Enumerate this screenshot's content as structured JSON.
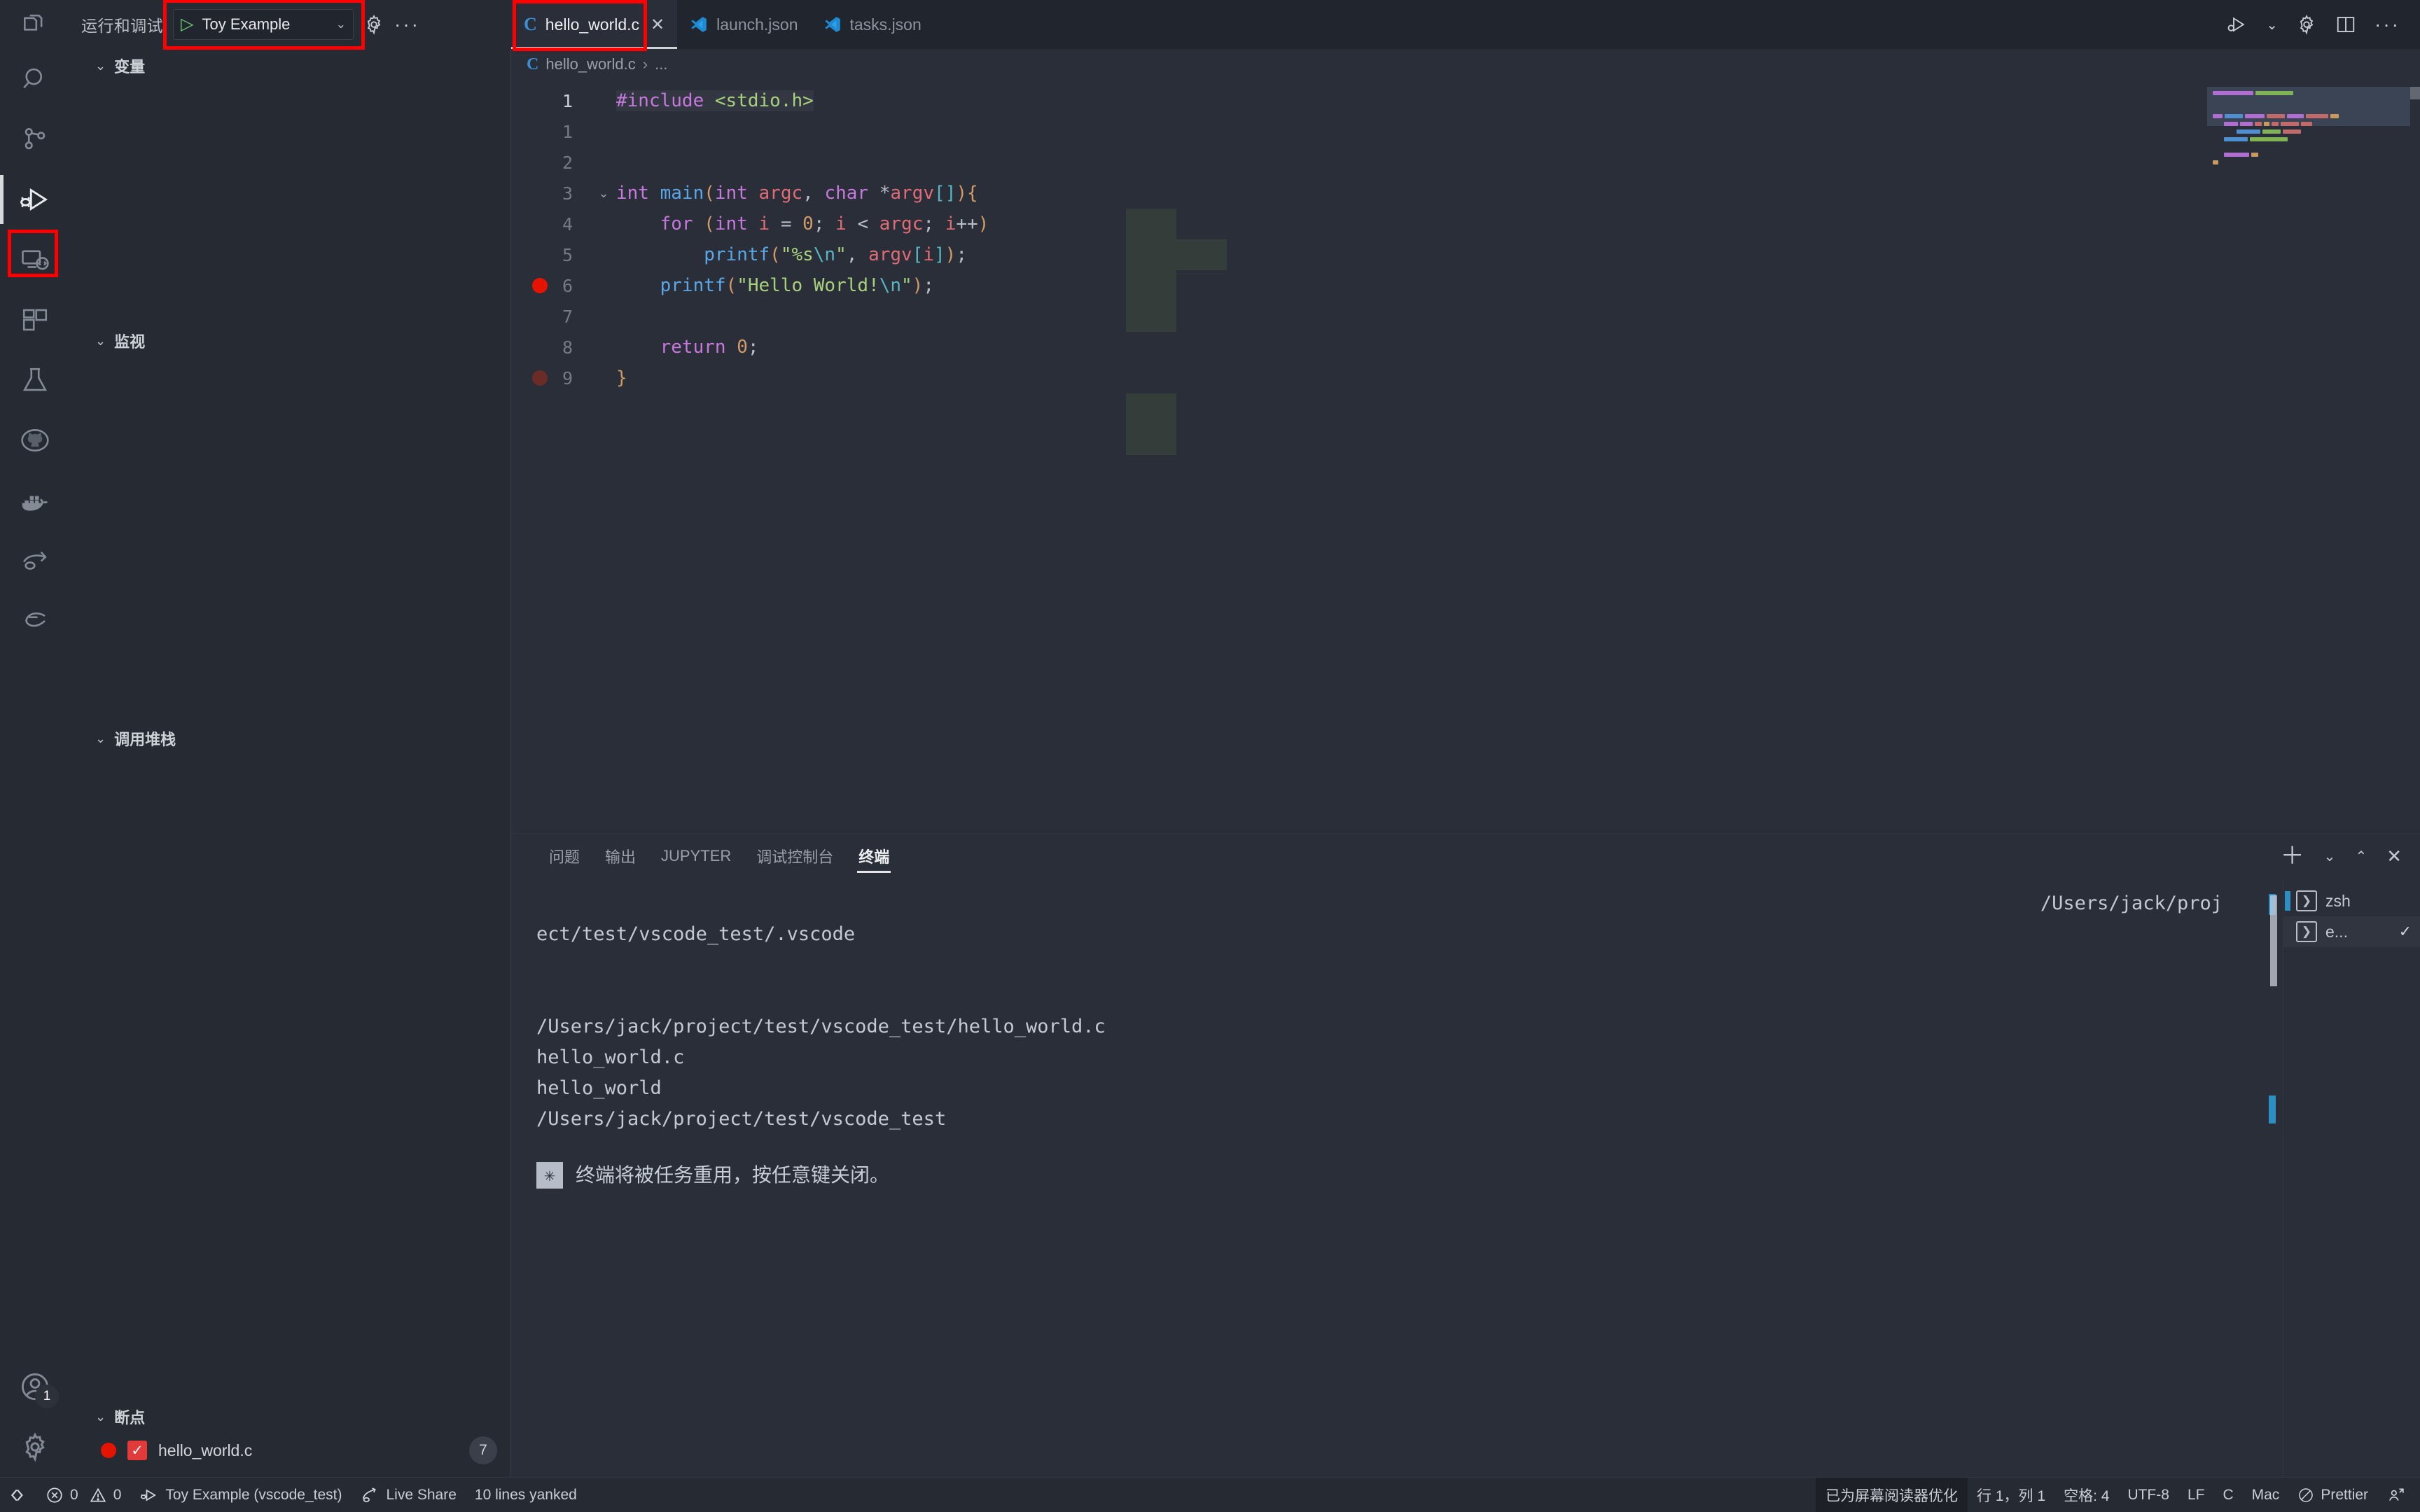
{
  "debug_header": {
    "title": "运行和调试",
    "config_name": "Toy Example",
    "play_icon": "play-icon",
    "chevron": "chevron-down-icon",
    "gear_icon": "gear-icon",
    "more_icon": "ellipsis-icon"
  },
  "activity_bar": {
    "items": [
      {
        "name": "explorer",
        "icon": "files-icon"
      },
      {
        "name": "search",
        "icon": "search-icon"
      },
      {
        "name": "source-control",
        "icon": "source-control-icon"
      },
      {
        "name": "run-and-debug",
        "icon": "run-debug-icon",
        "active": true
      },
      {
        "name": "remote-explorer",
        "icon": "remote-explorer-icon"
      },
      {
        "name": "extensions",
        "icon": "extensions-icon"
      },
      {
        "name": "testing",
        "icon": "beaker-icon"
      },
      {
        "name": "github",
        "icon": "github-icon"
      },
      {
        "name": "docker",
        "icon": "docker-icon"
      },
      {
        "name": "live-share",
        "icon": "live-share-icon"
      },
      {
        "name": "codeium",
        "icon": "codeium-icon"
      }
    ],
    "account_badge": "1",
    "account_icon": "account-icon",
    "settings_icon": "gear-icon"
  },
  "sidebar": {
    "sections": [
      {
        "label": "变量",
        "expanded": true
      },
      {
        "label": "监视",
        "expanded": true
      },
      {
        "label": "调用堆栈",
        "expanded": true
      },
      {
        "label": "断点",
        "expanded": true
      }
    ],
    "breakpoints": [
      {
        "file": "hello_world.c",
        "line": "7",
        "enabled": true
      }
    ]
  },
  "tabs": [
    {
      "label": "hello_world.c",
      "icon": "c-file-icon",
      "active": true,
      "close": "✕"
    },
    {
      "label": "launch.json",
      "icon": "json-vscode-icon",
      "active": false
    },
    {
      "label": "tasks.json",
      "icon": "json-vscode-icon",
      "active": false
    }
  ],
  "tabbar_actions": [
    {
      "name": "run-debug-dropdown",
      "icon": "run-debug-icon"
    },
    {
      "name": "chevron-down-icon",
      "icon": "chevron-down-icon"
    },
    {
      "name": "settings",
      "icon": "gear-icon"
    },
    {
      "name": "split-editor",
      "icon": "split-editor-icon"
    },
    {
      "name": "more-actions",
      "icon": "ellipsis-icon"
    }
  ],
  "breadcrumb": {
    "icon": "c-file-icon",
    "file": "hello_world.c",
    "separator": "›",
    "more": "..."
  },
  "editor": {
    "lines": [
      {
        "num": "1",
        "current": true,
        "breakpoint": "none",
        "tokens": [
          {
            "t": "#include ",
            "c": "pre"
          },
          {
            "t": "<stdio.h>",
            "c": "hdrfile"
          }
        ]
      },
      {
        "num": "1",
        "current": false,
        "breakpoint": "none",
        "tokens": []
      },
      {
        "num": "2",
        "current": false,
        "breakpoint": "none",
        "tokens": []
      },
      {
        "num": "3",
        "current": false,
        "breakpoint": "none",
        "fold": "⌄",
        "tokens": [
          {
            "t": "int ",
            "c": "kw"
          },
          {
            "t": "main",
            "c": "fn"
          },
          {
            "t": "(",
            "c": "bracket1"
          },
          {
            "t": "int ",
            "c": "kw"
          },
          {
            "t": "argc",
            "c": "var"
          },
          {
            "t": ", ",
            "c": "punc"
          },
          {
            "t": "char ",
            "c": "kw"
          },
          {
            "t": "*",
            "c": "punc"
          },
          {
            "t": "argv",
            "c": "var"
          },
          {
            "t": "[",
            "c": "bracket2"
          },
          {
            "t": "]",
            "c": "bracket2"
          },
          {
            "t": ")",
            "c": "bracket1"
          },
          {
            "t": "{",
            "c": "bracket1"
          }
        ]
      },
      {
        "num": "4",
        "current": false,
        "breakpoint": "none",
        "tokens": [
          {
            "t": "    ",
            "c": "punc"
          },
          {
            "t": "for ",
            "c": "kw"
          },
          {
            "t": "(",
            "c": "bracket1"
          },
          {
            "t": "int ",
            "c": "kw"
          },
          {
            "t": "i ",
            "c": "var"
          },
          {
            "t": "= ",
            "c": "punc"
          },
          {
            "t": "0",
            "c": "num"
          },
          {
            "t": "; ",
            "c": "punc"
          },
          {
            "t": "i ",
            "c": "var"
          },
          {
            "t": "< ",
            "c": "punc"
          },
          {
            "t": "argc",
            "c": "var"
          },
          {
            "t": "; ",
            "c": "punc"
          },
          {
            "t": "i",
            "c": "var"
          },
          {
            "t": "++",
            "c": "punc"
          },
          {
            "t": ")",
            "c": "bracket1"
          }
        ]
      },
      {
        "num": "5",
        "current": false,
        "breakpoint": "none",
        "tokens": [
          {
            "t": "        ",
            "c": "punc"
          },
          {
            "t": "printf",
            "c": "fn"
          },
          {
            "t": "(",
            "c": "bracket1"
          },
          {
            "t": "\"%s",
            "c": "str"
          },
          {
            "t": "\\n",
            "c": "esc"
          },
          {
            "t": "\"",
            "c": "str"
          },
          {
            "t": ", ",
            "c": "punc"
          },
          {
            "t": "argv",
            "c": "var"
          },
          {
            "t": "[",
            "c": "bracket2"
          },
          {
            "t": "i",
            "c": "var"
          },
          {
            "t": "]",
            "c": "bracket2"
          },
          {
            "t": ")",
            "c": "bracket1"
          },
          {
            "t": ";",
            "c": "punc"
          }
        ]
      },
      {
        "num": "6",
        "current": false,
        "breakpoint": "on",
        "tokens": [
          {
            "t": "    ",
            "c": "punc"
          },
          {
            "t": "printf",
            "c": "fn"
          },
          {
            "t": "(",
            "c": "bracket1"
          },
          {
            "t": "\"Hello World!",
            "c": "str"
          },
          {
            "t": "\\n",
            "c": "esc"
          },
          {
            "t": "\"",
            "c": "str"
          },
          {
            "t": ")",
            "c": "bracket1"
          },
          {
            "t": ";",
            "c": "punc"
          }
        ]
      },
      {
        "num": "7",
        "current": false,
        "breakpoint": "none",
        "tokens": []
      },
      {
        "num": "8",
        "current": false,
        "breakpoint": "none",
        "tokens": [
          {
            "t": "    ",
            "c": "punc"
          },
          {
            "t": "return ",
            "c": "kw"
          },
          {
            "t": "0",
            "c": "num"
          },
          {
            "t": ";",
            "c": "punc"
          }
        ]
      },
      {
        "num": "9",
        "current": false,
        "breakpoint": "dim",
        "tokens": [
          {
            "t": "}",
            "c": "bracket1"
          }
        ]
      }
    ]
  },
  "panel": {
    "tabs": [
      {
        "label": "问题",
        "active": false
      },
      {
        "label": "输出",
        "active": false
      },
      {
        "label": "JUPYTER",
        "active": false
      },
      {
        "label": "调试控制台",
        "active": false
      },
      {
        "label": "终端",
        "active": true
      }
    ],
    "actions": [
      {
        "name": "new-terminal",
        "icon": "plus-icon"
      },
      {
        "name": "terminal-dropdown",
        "icon": "chevron-down-icon"
      },
      {
        "name": "maximize-panel",
        "icon": "chevron-up-icon"
      },
      {
        "name": "close-panel",
        "icon": "close-icon"
      }
    ],
    "terminal_lines": [
      {
        "text": "/Users/jack/proj",
        "align": "right"
      },
      {
        "text": "ect/test/vscode_test/.vscode",
        "align": "left"
      },
      {
        "text": "",
        "align": "left"
      },
      {
        "text": "",
        "align": "left"
      },
      {
        "text": "/Users/jack/project/test/vscode_test/hello_world.c",
        "align": "left"
      },
      {
        "text": " hello_world.c",
        "align": "left"
      },
      {
        "text": " hello_world",
        "align": "left"
      },
      {
        "text": " /Users/jack/project/test/vscode_test",
        "align": "left"
      }
    ],
    "task_note": {
      "marker": "✳",
      "text": "终端将被任务重用，按任意键关闭。"
    },
    "terminal_list": [
      {
        "label": "zsh",
        "icon": "terminal-icon",
        "active": false,
        "selected": true,
        "check": ""
      },
      {
        "label": "e...",
        "icon": "terminal-icon",
        "active": true,
        "selected": false,
        "check": "✓"
      }
    ]
  },
  "status_bar": {
    "left": [
      {
        "name": "remote-window",
        "icon": "remote-icon",
        "label": ""
      },
      {
        "name": "problems",
        "icon": "error-icon",
        "label": "0",
        "icon2": "warning-icon",
        "label2": "0"
      },
      {
        "name": "debug-config",
        "icon": "run-debug-icon",
        "label": "Toy Example (vscode_test)"
      },
      {
        "name": "live-share",
        "icon": "live-share-icon",
        "label": "Live Share"
      },
      {
        "name": "yank-status",
        "label": "10 lines yanked"
      }
    ],
    "right": [
      {
        "name": "screen-reader",
        "label": "已为屏幕阅读器优化",
        "highlight": true
      },
      {
        "name": "cursor-position",
        "label": "行 1，列 1"
      },
      {
        "name": "indentation",
        "label": "空格: 4"
      },
      {
        "name": "encoding",
        "label": "UTF-8"
      },
      {
        "name": "eol",
        "label": "LF"
      },
      {
        "name": "language-mode",
        "label": "C"
      },
      {
        "name": "keymap",
        "label": "Mac"
      },
      {
        "name": "prettier",
        "icon": "prettier-icon",
        "label": "Prettier"
      },
      {
        "name": "feedback",
        "icon": "feedback-icon",
        "label": ""
      }
    ]
  },
  "colors": {
    "accent_red": "#fe0000",
    "breakpoint_red": "#e51400",
    "play_green": "#6fd07a",
    "editor_bg": "#2a2e38",
    "chrome_bg": "#262a33",
    "cursor_blue": "#2b8fc4"
  }
}
